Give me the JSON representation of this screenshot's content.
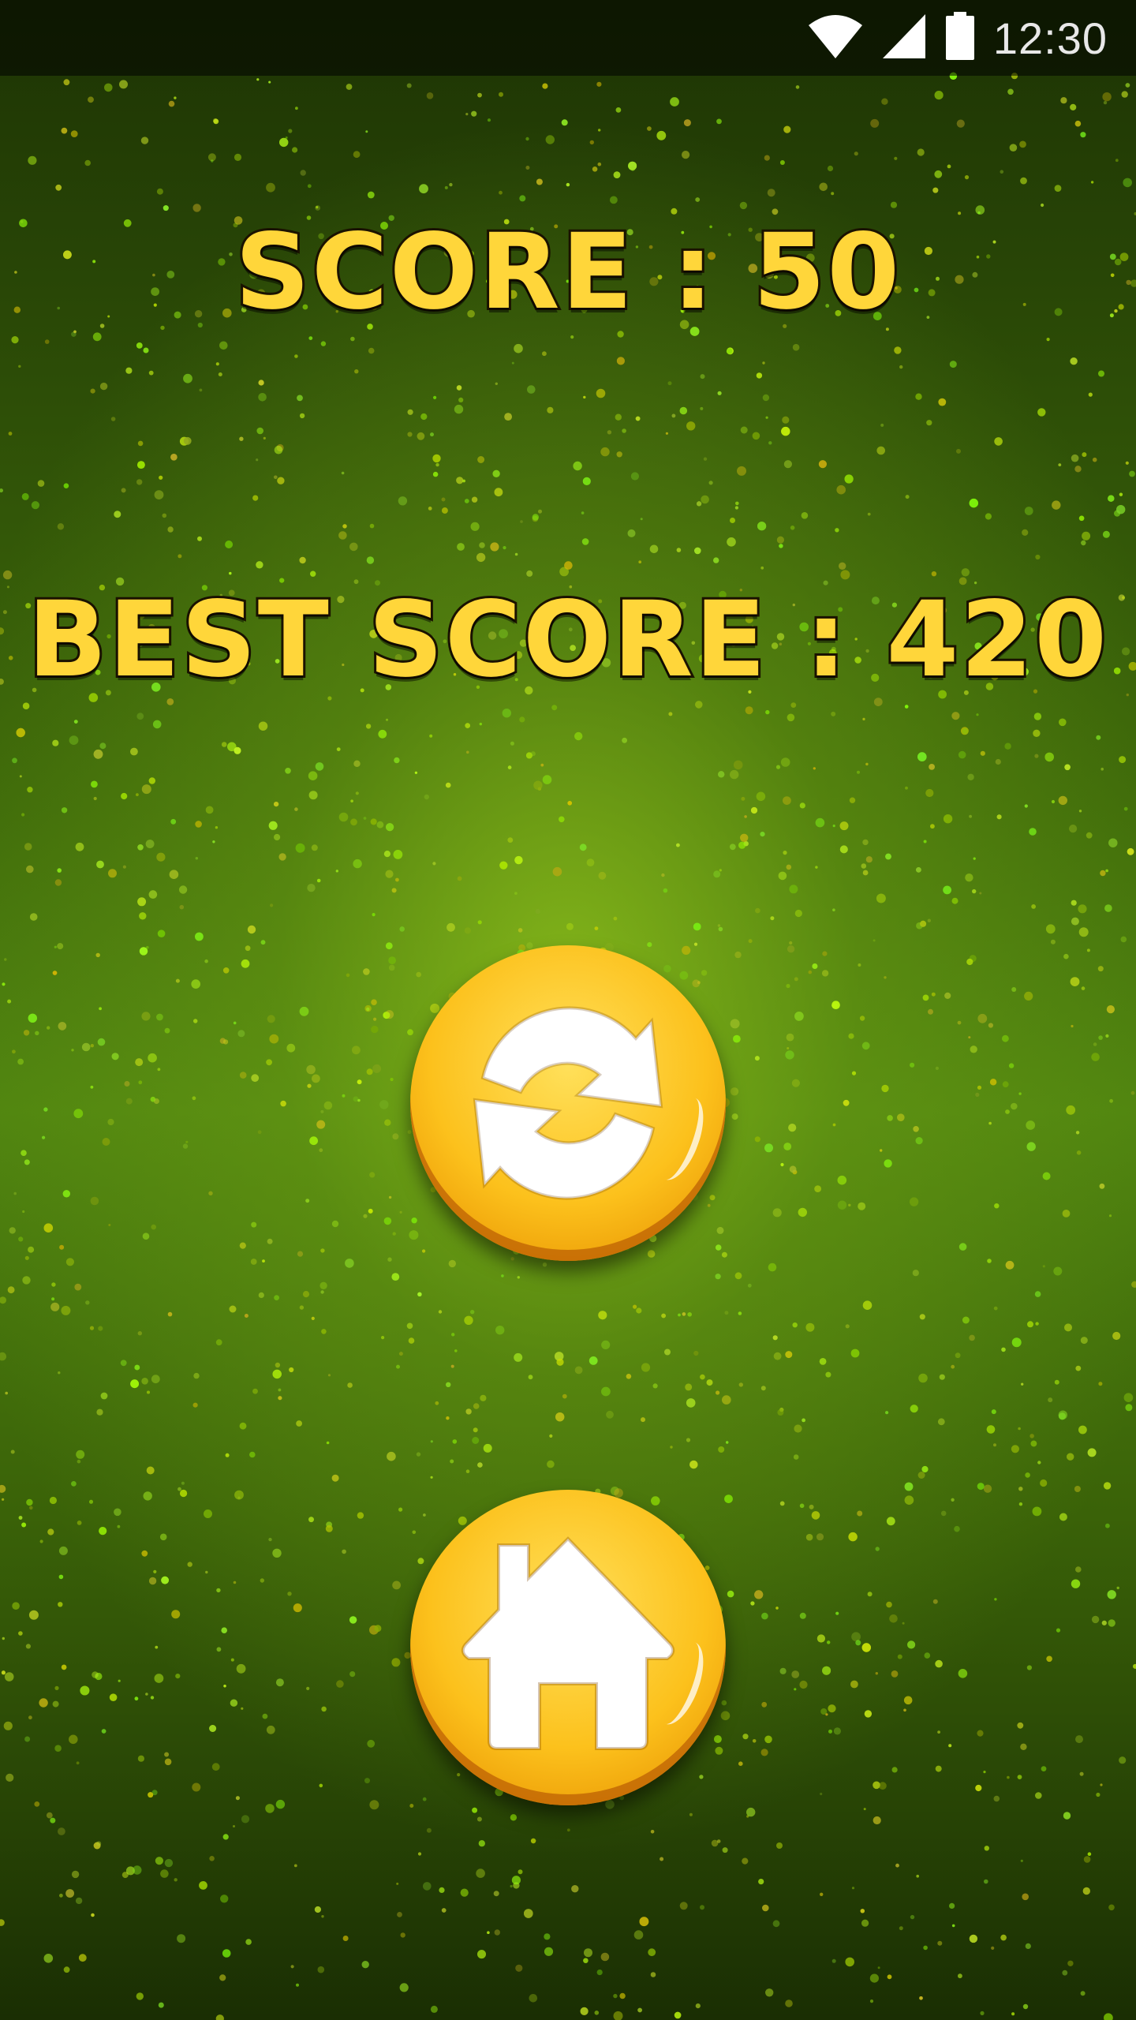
{
  "status_bar": {
    "time": "12:30",
    "icons": [
      "wifi-icon",
      "cellular-signal-icon",
      "battery-icon"
    ]
  },
  "game_over": {
    "score_text": "SCORE : 50",
    "best_score_text": "BEST SCORE : 420"
  },
  "buttons": {
    "replay_icon": "replay-icon",
    "home_icon": "home-icon"
  },
  "colors": {
    "accent_text": "#ffd63a",
    "button_orange": "#fcc11c",
    "background_green": "#4f8410"
  }
}
